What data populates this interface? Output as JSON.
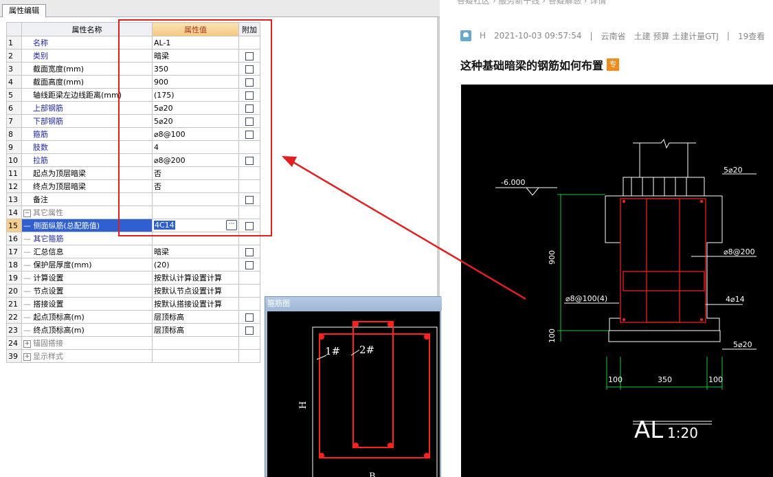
{
  "editor": {
    "tab_label": "属性编辑",
    "headers": {
      "name": "属性名称",
      "value": "属性值",
      "extra": "附加"
    },
    "rows": [
      {
        "num": "1",
        "name": "名称",
        "value": "AL-1",
        "style": "blue",
        "check": false,
        "indent": ""
      },
      {
        "num": "2",
        "name": "类别",
        "value": "暗梁",
        "style": "blue",
        "check": true,
        "indent": ""
      },
      {
        "num": "3",
        "name": "截面宽度(mm)",
        "value": "350",
        "style": "black",
        "check": true,
        "indent": ""
      },
      {
        "num": "4",
        "name": "截面高度(mm)",
        "value": "900",
        "style": "black",
        "check": true,
        "indent": ""
      },
      {
        "num": "5",
        "name": "轴线距梁左边线距离(mm)",
        "value": "(175)",
        "style": "black",
        "check": true,
        "indent": ""
      },
      {
        "num": "6",
        "name": "上部钢筋",
        "value": "5⌀20",
        "style": "blue",
        "check": true,
        "indent": ""
      },
      {
        "num": "7",
        "name": "下部钢筋",
        "value": "5⌀20",
        "style": "blue",
        "check": true,
        "indent": ""
      },
      {
        "num": "8",
        "name": "箍筋",
        "value": "⌀8@100",
        "style": "blue",
        "check": true,
        "indent": ""
      },
      {
        "num": "9",
        "name": "肢数",
        "value": "4",
        "style": "blue",
        "check": false,
        "indent": ""
      },
      {
        "num": "10",
        "name": "拉筋",
        "value": "⌀8@200",
        "style": "blue",
        "check": true,
        "indent": ""
      },
      {
        "num": "11",
        "name": "起点为顶层暗梁",
        "value": "否",
        "style": "black",
        "check": false,
        "indent": ""
      },
      {
        "num": "12",
        "name": "终点为顶层暗梁",
        "value": "否",
        "style": "black",
        "check": false,
        "indent": ""
      },
      {
        "num": "13",
        "name": "备注",
        "value": "",
        "style": "black",
        "check": true,
        "indent": ""
      },
      {
        "num": "14",
        "name": "其它属性",
        "value": "",
        "style": "gray",
        "check": false,
        "indent": "",
        "expander": "−"
      },
      {
        "num": "15",
        "name": "侧面纵筋(总配筋值)",
        "value": "4C14",
        "style": "blue",
        "check": true,
        "indent": "—",
        "selected": true
      },
      {
        "num": "16",
        "name": "其它箍筋",
        "value": "",
        "style": "blue",
        "check": false,
        "indent": "—"
      },
      {
        "num": "17",
        "name": "汇总信息",
        "value": "暗梁",
        "style": "black",
        "check": true,
        "indent": "—"
      },
      {
        "num": "18",
        "name": "保护层厚度(mm)",
        "value": "(20)",
        "style": "black",
        "check": true,
        "indent": "—"
      },
      {
        "num": "19",
        "name": "计算设置",
        "value": "按默认计算设置计算",
        "style": "black",
        "check": false,
        "indent": "—"
      },
      {
        "num": "20",
        "name": "节点设置",
        "value": "按默认节点设置计算",
        "style": "black",
        "check": false,
        "indent": "—"
      },
      {
        "num": "21",
        "name": "搭接设置",
        "value": "按默认搭接设置计算",
        "style": "black",
        "check": false,
        "indent": "—"
      },
      {
        "num": "22",
        "name": "起点顶标高(m)",
        "value": "层顶标高",
        "style": "black",
        "check": true,
        "indent": "—"
      },
      {
        "num": "23",
        "name": "终点顶标高(m)",
        "value": "层顶标高",
        "style": "black",
        "check": true,
        "indent": "—"
      },
      {
        "num": "24",
        "name": "锚固搭接",
        "value": "",
        "style": "gray",
        "check": false,
        "indent": "",
        "expander": "+"
      },
      {
        "num": "39",
        "name": "显示样式",
        "value": "",
        "style": "gray",
        "check": false,
        "indent": "",
        "expander": "+"
      }
    ],
    "ellipsis_label": "···"
  },
  "stirrup": {
    "title": "箍筋图",
    "label_1": "1#",
    "label_2": "2#",
    "label_h": "H",
    "label_b": "B"
  },
  "post": {
    "breadcrumb": "答疑社区 › 服务新干线 › 答疑解惑 › 详情",
    "author": "H",
    "date": "2021-10-03 09:57:54",
    "sep": "|",
    "region": "云南省",
    "category": "土建 预算 土建计量GTJ",
    "views": "19查看",
    "title": "这种基础暗梁的钢筋如何布置",
    "badge": "专"
  },
  "cad": {
    "label_top_rebar": "5⌀20",
    "label_elev": "-6.000",
    "label_tie": "⌀8@200",
    "label_stirrup": "⌀8@100(4)",
    "label_side": "4⌀14",
    "label_bottom_rebar": "5⌀20",
    "label_height": "900",
    "label_base": "100",
    "label_w_left": "100",
    "label_w_mid": "350",
    "label_w_right": "100",
    "label_title": "AL",
    "label_scale": "1:20"
  },
  "colors": {
    "accent_red": "#e02020",
    "selection": "#2f5fd0",
    "header_orange": "#f5c880",
    "cad_bg": "#000000"
  }
}
